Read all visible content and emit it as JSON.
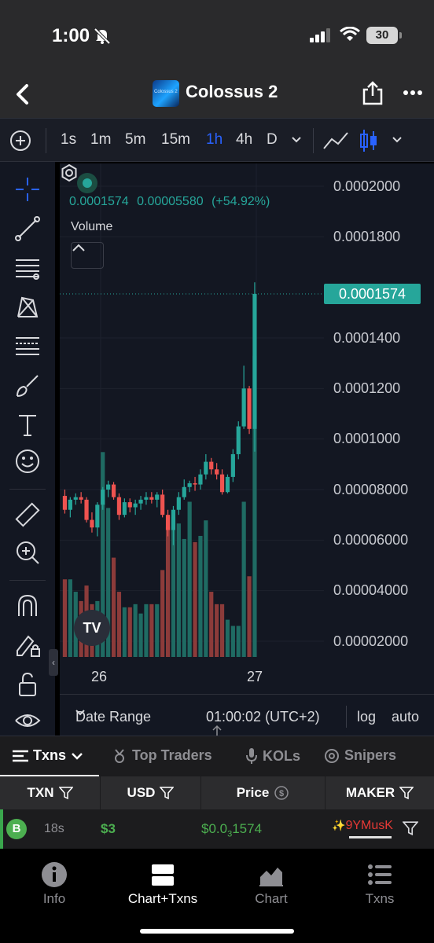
{
  "status_bar": {
    "time": "1:00",
    "battery": "30"
  },
  "header": {
    "title": "Colossus 2",
    "logo_text": "Colossus 2"
  },
  "timeframes": [
    {
      "label": "1s",
      "active": false
    },
    {
      "label": "1m",
      "active": false
    },
    {
      "label": "5m",
      "active": false
    },
    {
      "label": "15m",
      "active": false
    },
    {
      "label": "1h",
      "active": true
    },
    {
      "label": "4h",
      "active": false
    },
    {
      "label": "D",
      "active": false
    }
  ],
  "tools": [
    "crosshair-icon",
    "trend-line-icon",
    "horizontal-lines-icon",
    "pattern-icon",
    "fib-icon",
    "brush-icon",
    "text-tool-icon",
    "emoji-icon",
    "ruler-icon",
    "zoom-in-icon",
    "magnet-icon",
    "pencil-lock-icon",
    "unlock-icon",
    "eye-icon"
  ],
  "legend": {
    "price": "0.0001574",
    "change": "0.00005580",
    "change_pct": "(+54.92%)",
    "volume_label": "Volume"
  },
  "y_axis_ticks": [
    "0.0002000",
    "0.0001800",
    "0.0001400",
    "0.0001200",
    "0.0001000",
    "0.00008000",
    "0.00006000",
    "0.00004000",
    "0.00002000"
  ],
  "last_price_tag": "0.0001574",
  "x_axis_ticks": [
    "26",
    "27"
  ],
  "chart_bottom": {
    "date_range": "Date Range",
    "clock": "01:00:02 (UTC+2)",
    "log": "log",
    "auto": "auto"
  },
  "colors": {
    "up": "#26a69a",
    "down": "#ef5350",
    "accent": "#2962ff"
  },
  "tabs": [
    {
      "label": "Txns",
      "active": true
    },
    {
      "label": "Top Traders",
      "active": false
    },
    {
      "label": "KOLs",
      "active": false
    },
    {
      "label": "Snipers",
      "active": false
    }
  ],
  "table": {
    "columns": [
      "TXN",
      "USD",
      "Price",
      "MAKER"
    ],
    "rows": [
      {
        "type": "B",
        "age": "18s",
        "usd": "$3",
        "price_prefix": "$0.0",
        "price_sub": "3",
        "price_rest": "1574",
        "maker": "9YMusK"
      }
    ]
  },
  "nav": [
    {
      "label": "Info",
      "icon": "info-icon",
      "active": false
    },
    {
      "label": "Chart+Txns",
      "icon": "chart-txns-icon",
      "active": true
    },
    {
      "label": "Chart",
      "icon": "chart-icon",
      "active": false
    },
    {
      "label": "Txns",
      "icon": "txns-list-icon",
      "active": false
    }
  ],
  "chart_data": {
    "type": "candlestick",
    "y_axis_ticks": [
      2e-05,
      4e-05,
      6e-05,
      8e-05,
      0.0001,
      0.00012,
      0.00014,
      0.00018,
      0.0002
    ],
    "x_ticks": [
      "26",
      "27"
    ],
    "last_price": 0.0001574,
    "candles": [
      {
        "o": 7.75e-05,
        "h": 8e-05,
        "l": 7.05e-05,
        "c": 7.2e-05,
        "v": 1.25e-05
      },
      {
        "o": 7.2e-05,
        "h": 7.7e-05,
        "l": 6.9e-05,
        "c": 7.6e-05,
        "v": 1.25e-05
      },
      {
        "o": 7.6e-05,
        "h": 7.85e-05,
        "l": 7.4e-05,
        "c": 7.7e-05,
        "v": 1.05e-05
      },
      {
        "o": 7.7e-05,
        "h": 7.9e-05,
        "l": 7.45e-05,
        "c": 7.6e-05,
        "v": 9e-06
      },
      {
        "o": 7.6e-05,
        "h": 7.7e-05,
        "l": 6.7e-05,
        "c": 6.8e-05,
        "v": 1.15e-05
      },
      {
        "o": 6.8e-05,
        "h": 7.1e-05,
        "l": 6.3e-05,
        "c": 6.5e-05,
        "v": 8.5e-06
      },
      {
        "o": 6.5e-05,
        "h": 7.5e-05,
        "l": 6.15e-05,
        "c": 7.4e-05,
        "v": 9e-06
      },
      {
        "o": 7.4e-05,
        "h": 8.1e-05,
        "l": 7.2e-05,
        "c": 8e-05,
        "v": 3.3e-05
      },
      {
        "o": 8e-05,
        "h": 8.35e-05,
        "l": 7.7e-05,
        "c": 8.2e-05,
        "v": 2.4e-05
      },
      {
        "o": 8.2e-05,
        "h": 8.3e-05,
        "l": 7.6e-05,
        "c": 7.7e-05,
        "v": 1.6e-05
      },
      {
        "o": 7.7e-05,
        "h": 7.85e-05,
        "l": 6.8e-05,
        "c": 7e-05,
        "v": 1.05e-05
      },
      {
        "o": 7e-05,
        "h": 7.65e-05,
        "l": 6.9e-05,
        "c": 7.5e-05,
        "v": 8e-06
      },
      {
        "o": 7.5e-05,
        "h": 7.65e-05,
        "l": 7.1e-05,
        "c": 7.3e-05,
        "v": 8e-06
      },
      {
        "o": 7.3e-05,
        "h": 7.6e-05,
        "l": 7e-05,
        "c": 7.45e-05,
        "v": 8.5e-06
      },
      {
        "o": 7.45e-05,
        "h": 7.75e-05,
        "l": 7.2e-05,
        "c": 7.6e-05,
        "v": 7e-06
      },
      {
        "o": 7.6e-05,
        "h": 7.9e-05,
        "l": 7.4e-05,
        "c": 7.7e-05,
        "v": 8.5e-06
      },
      {
        "o": 7.7e-05,
        "h": 7.9e-05,
        "l": 7.45e-05,
        "c": 7.6e-05,
        "v": 8.5e-06
      },
      {
        "o": 7.6e-05,
        "h": 7.9e-05,
        "l": 7.3e-05,
        "c": 7.8e-05,
        "v": 8.5e-06
      },
      {
        "o": 7.8e-05,
        "h": 8e-05,
        "l": 6.9e-05,
        "c": 7e-05,
        "v": 1.4e-05
      },
      {
        "o": 7e-05,
        "h": 7.2e-05,
        "l": 6.15e-05,
        "c": 6.4e-05,
        "v": 2.1e-05
      },
      {
        "o": 6.4e-05,
        "h": 7.35e-05,
        "l": 5.8e-05,
        "c": 7.2e-05,
        "v": 2.25e-05
      },
      {
        "o": 7.2e-05,
        "h": 7.9e-05,
        "l": 7e-05,
        "c": 7.7e-05,
        "v": 2.15e-05
      },
      {
        "o": 7.7e-05,
        "h": 8.4e-05,
        "l": 7.6e-05,
        "c": 8.1e-05,
        "v": 1.9e-05
      },
      {
        "o": 8.1e-05,
        "h": 8.35e-05,
        "l": 7.9e-05,
        "c": 8.25e-05,
        "v": 2.5e-05
      },
      {
        "o": 8.25e-05,
        "h": 8.5e-05,
        "l": 7.95e-05,
        "c": 8.2e-05,
        "v": 1.85e-05
      },
      {
        "o": 8.2e-05,
        "h": 8.8e-05,
        "l": 8e-05,
        "c": 8.6e-05,
        "v": 1.95e-05
      },
      {
        "o": 8.6e-05,
        "h": 9.4e-05,
        "l": 8.4e-05,
        "c": 9.1e-05,
        "v": 2.2e-05
      },
      {
        "o": 9.1e-05,
        "h": 9.25e-05,
        "l": 8.6e-05,
        "c": 8.8e-05,
        "v": 1.05e-05
      },
      {
        "o": 8.8e-05,
        "h": 9.05e-05,
        "l": 8.4e-05,
        "c": 8.6e-05,
        "v": 8.5e-06
      },
      {
        "o": 8.6e-05,
        "h": 8.8e-05,
        "l": 7.8e-05,
        "c": 7.9e-05,
        "v": 8.5e-06
      },
      {
        "o": 7.9e-05,
        "h": 8.6e-05,
        "l": 7.85e-05,
        "c": 8.5e-05,
        "v": 6e-06
      },
      {
        "o": 8.5e-05,
        "h": 9.6e-05,
        "l": 8.3e-05,
        "c": 9.4e-05,
        "v": 5e-06
      },
      {
        "o": 9.4e-05,
        "h": 0.000107,
        "l": 9.2e-05,
        "c": 0.000105,
        "v": 5e-06
      },
      {
        "o": 0.000105,
        "h": 0.000129,
        "l": 0.000104,
        "c": 0.00012,
        "v": 2.5e-05
      },
      {
        "o": 0.00012,
        "h": 0.000121,
        "l": 0.000102,
        "c": 0.000104,
        "v": 1.3e-05
      },
      {
        "o": 0.000104,
        "h": 0.000162,
        "l": 9.5e-05,
        "c": 0.0001574,
        "v": 4.85e-05
      }
    ]
  }
}
